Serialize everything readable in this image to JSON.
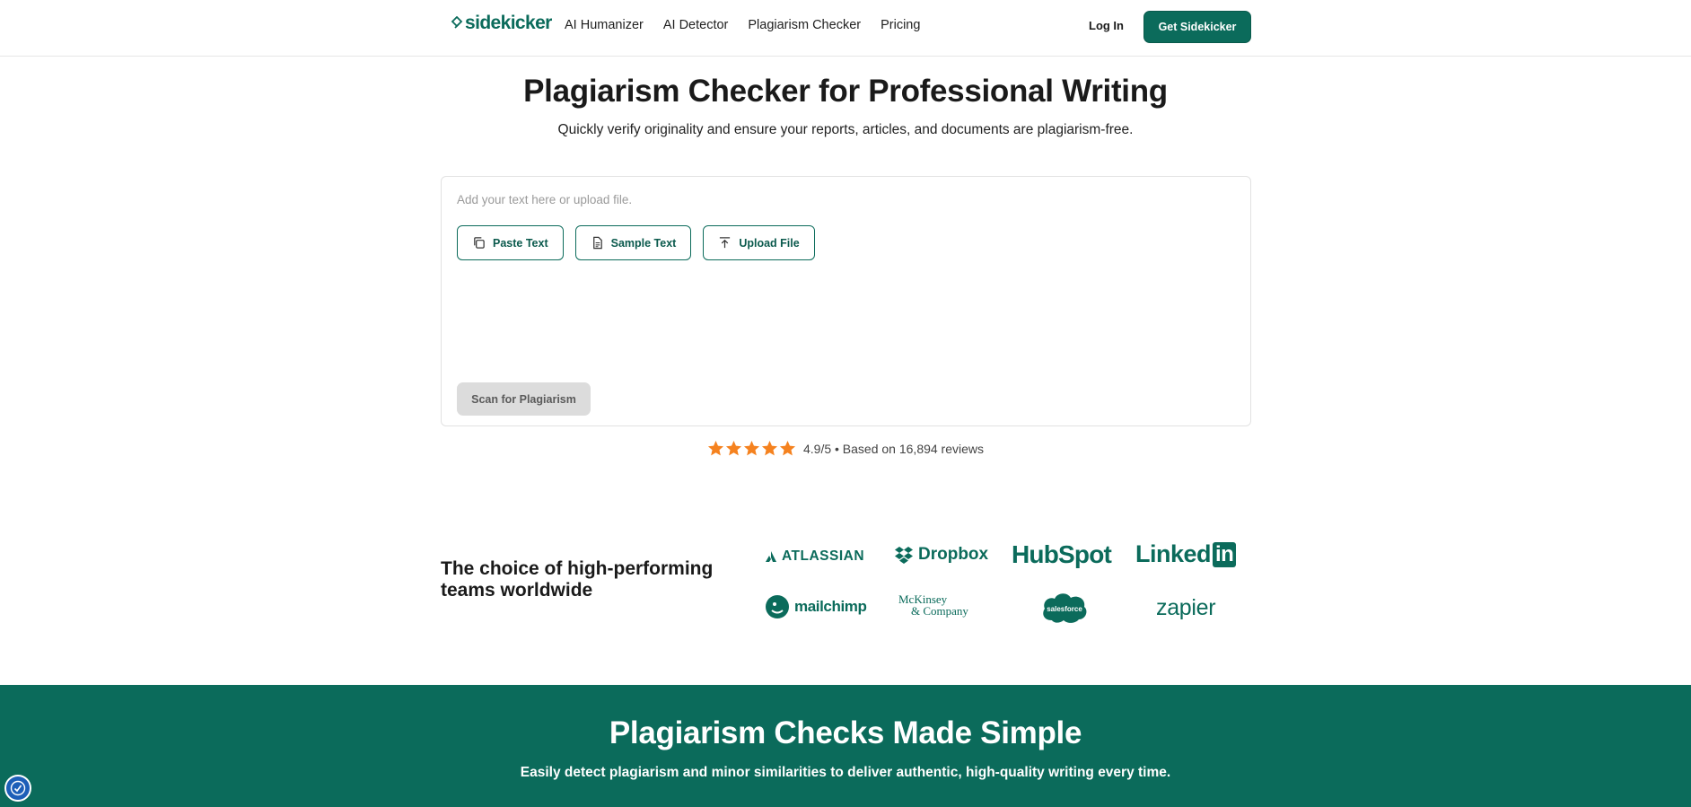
{
  "header": {
    "logo_text": "sidekicker",
    "nav": [
      "AI Humanizer",
      "AI Detector",
      "Plagiarism Checker",
      "Pricing"
    ],
    "login": "Log In",
    "cta": "Get Sidekicker"
  },
  "hero": {
    "title": "Plagiarism Checker for Professional Writing",
    "subtitle": "Quickly verify originality and ensure your reports, articles, and documents are plagiarism-free."
  },
  "editor": {
    "placeholder": "Add your text here or upload file.",
    "buttons": [
      {
        "label": "Paste Text",
        "icon": "copy-icon"
      },
      {
        "label": "Sample Text",
        "icon": "document-icon"
      },
      {
        "label": "Upload File",
        "icon": "upload-icon"
      }
    ],
    "scan_label": "Scan for Plagiarism"
  },
  "rating": {
    "stars": 5,
    "text": "4.9/5 • Based on 16,894 reviews"
  },
  "trust": {
    "title": "The choice of high-performing teams worldwide",
    "logos": [
      "ATLASSIAN",
      "Dropbox",
      "HubSpot",
      "Linked",
      "in",
      "mailchimp",
      "McKinsey",
      "& Company",
      "salesforce",
      "zapier"
    ]
  },
  "section2": {
    "title": "Plagiarism Checks Made Simple",
    "subtitle": "Easily detect plagiarism and minor similarities to deliver authentic, high-quality writing every time."
  },
  "colors": {
    "brand": "#0b6b5b",
    "star": "#f5821f",
    "scan_disabled": "#dcdcdc"
  }
}
